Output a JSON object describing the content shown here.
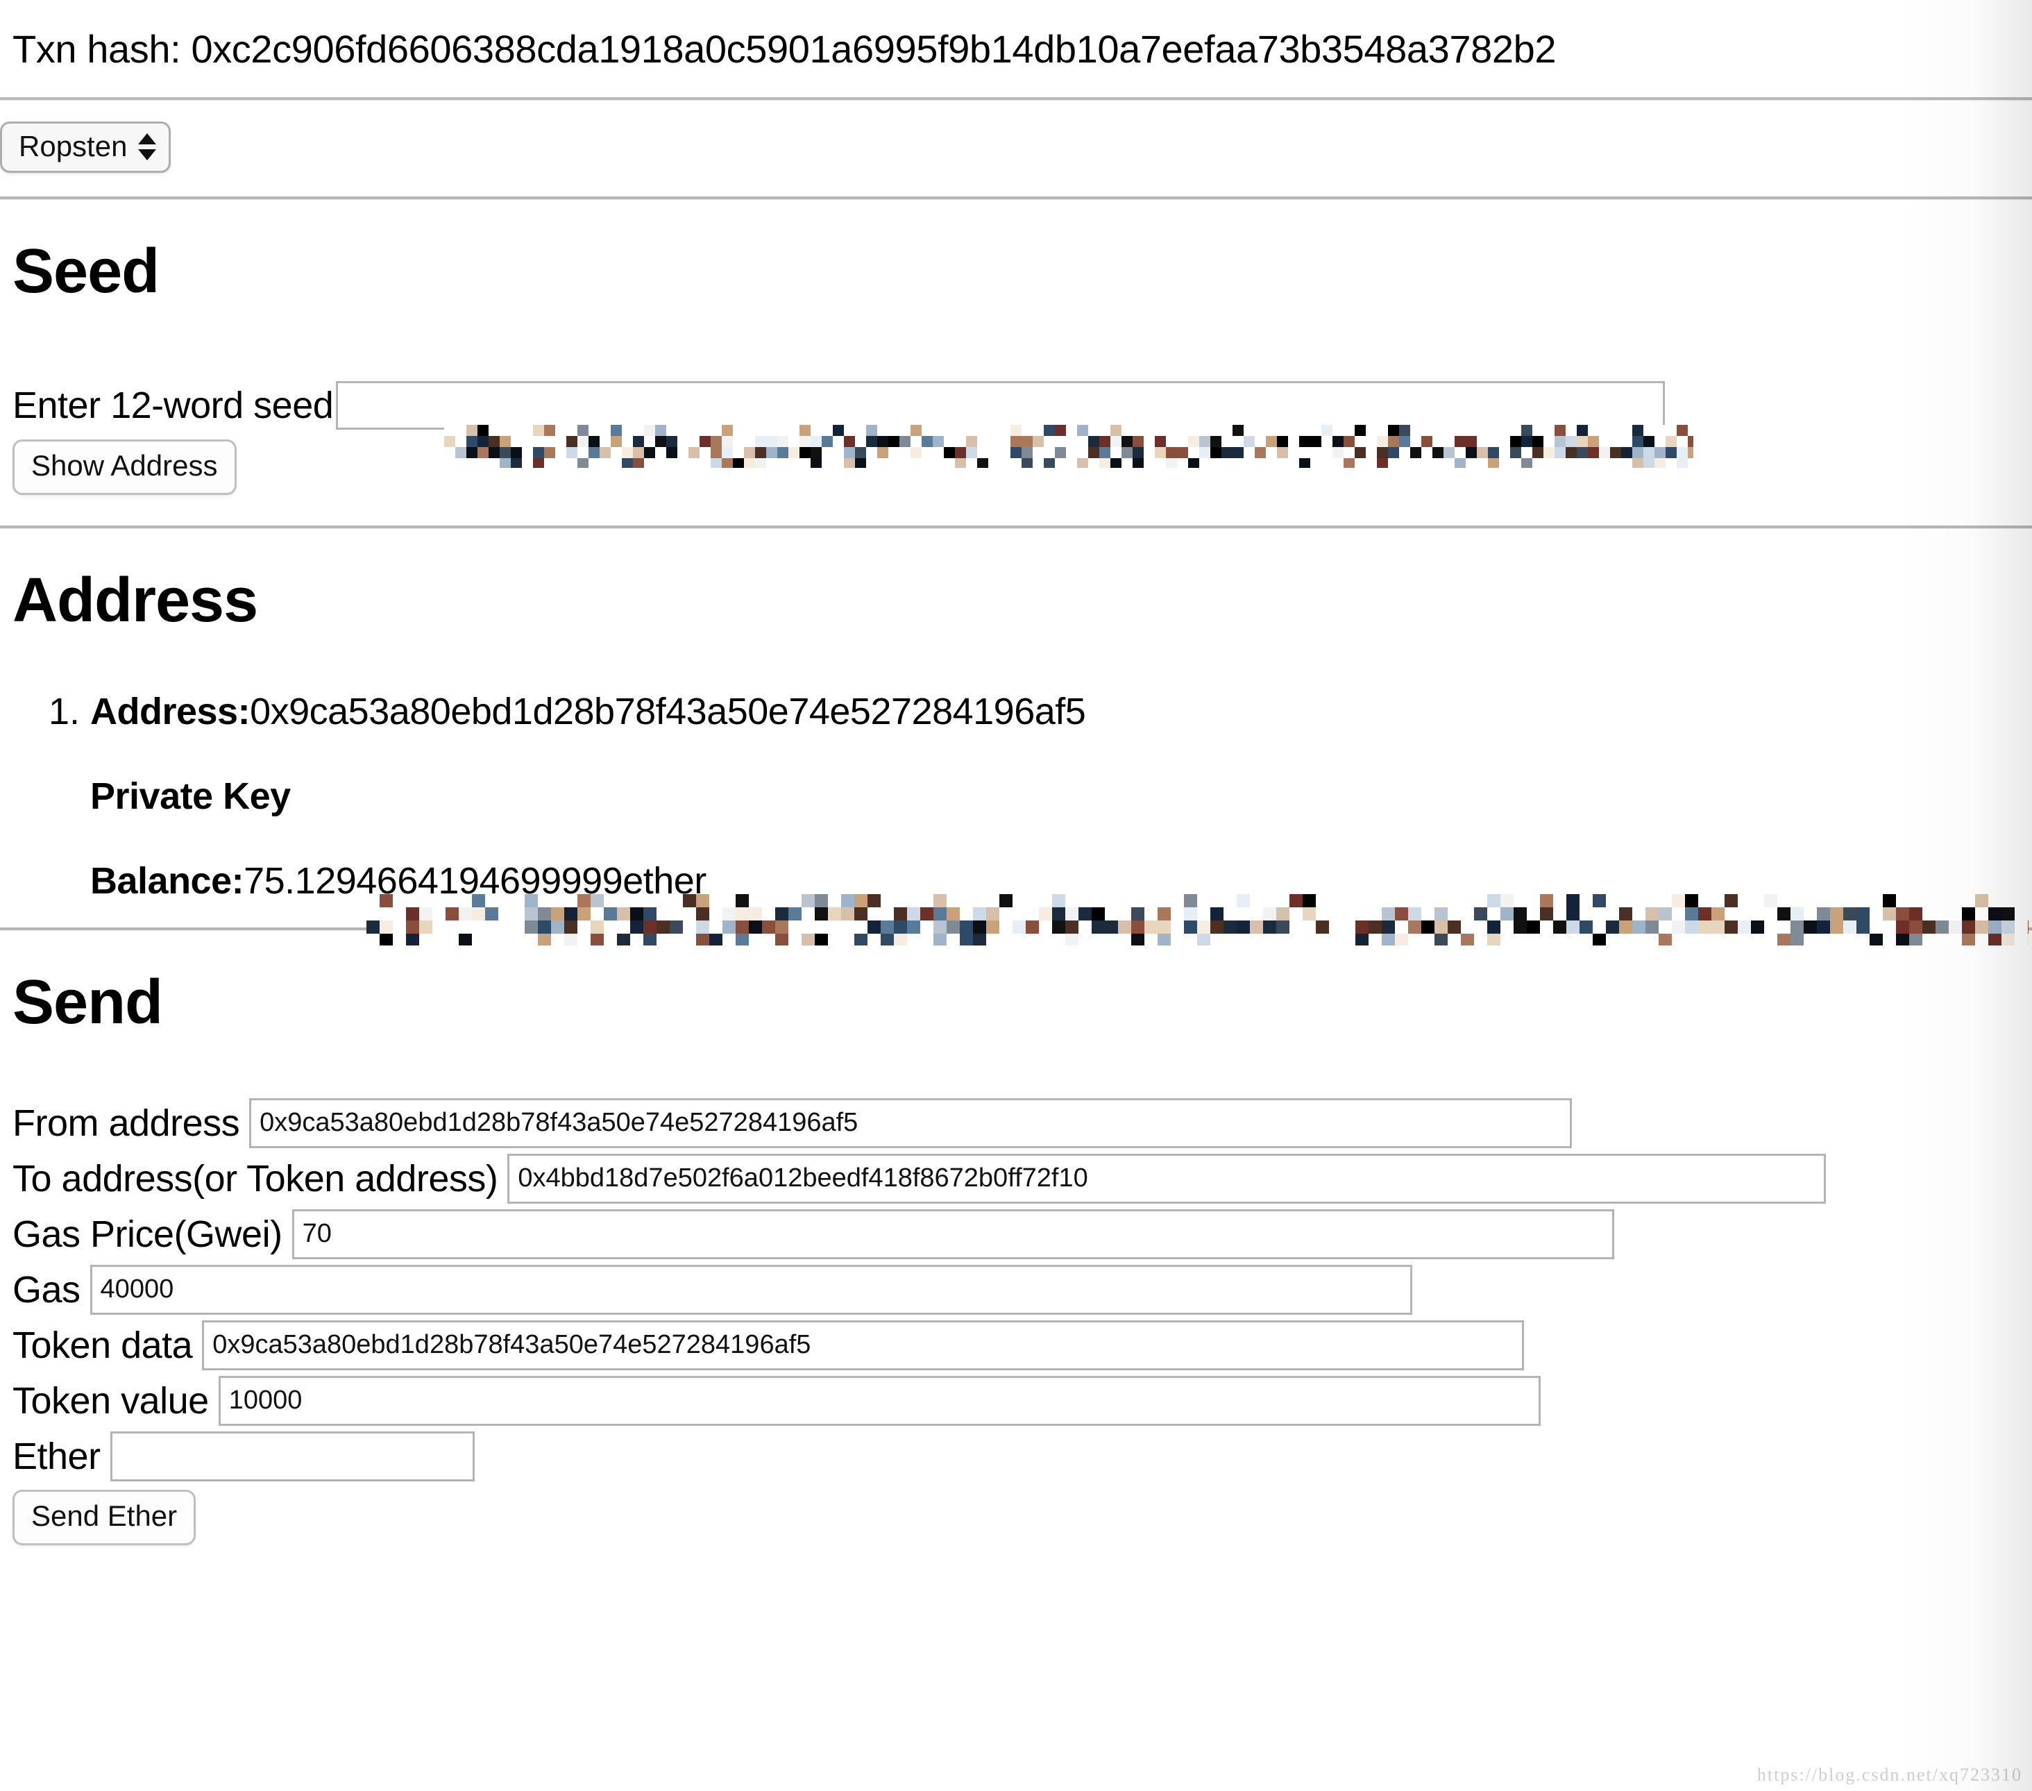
{
  "header": {
    "txn_hash_label": "Txn hash:",
    "txn_hash_value": "0xc2c906fd6606388cda1918a0c5901a6995f9b14db10a7eefaa73b3548a3782b2",
    "txn_hash_line": "Txn hash: 0xc2c906fd6606388cda1918a0c5901a6995f9b14db10a7eefaa73b3548a3782b2"
  },
  "network": {
    "selected": "Ropsten",
    "options": [
      "Ropsten"
    ]
  },
  "seed": {
    "heading": "Seed",
    "input_label": "Enter 12-word seed",
    "input_value": "",
    "input_value_censored": true,
    "show_address_button": "Show Address"
  },
  "address": {
    "heading": "Address",
    "items": [
      {
        "address_label": "Address:",
        "address_value": "0x9ca53a80ebd1d28b78f43a50e74e527284196af5",
        "private_key_label": "Private Key",
        "private_key_value": "",
        "private_key_censored": true,
        "balance_label": "Balance:",
        "balance_value": "75.1294664194699999ether"
      }
    ]
  },
  "send": {
    "heading": "Send",
    "fields": [
      {
        "label": "From address",
        "value": "0x9ca53a80ebd1d28b78f43a50e74e527284196af5"
      },
      {
        "label": "To address(or Token address)",
        "value": "0x4bbd18d7e502f6a012beedf418f8672b0ff72f10"
      },
      {
        "label": "Gas Price(Gwei)",
        "value": "70"
      },
      {
        "label": "Gas",
        "value": "40000"
      },
      {
        "label": "Token data",
        "value": "0x9ca53a80ebd1d28b78f43a50e74e527284196af5"
      },
      {
        "label": "Token value",
        "value": "10000"
      },
      {
        "label": "Ether",
        "value": ""
      }
    ],
    "send_button": "Send Ether"
  },
  "watermark": "https://blog.csdn.net/xq723310",
  "colors": {
    "page_background": "#ffffff",
    "text": "#000000",
    "rule": "#b7b7b7",
    "input_border": "#b3b3b3",
    "select_background": "#f7f7f7",
    "watermark": "#c9c9c9"
  }
}
